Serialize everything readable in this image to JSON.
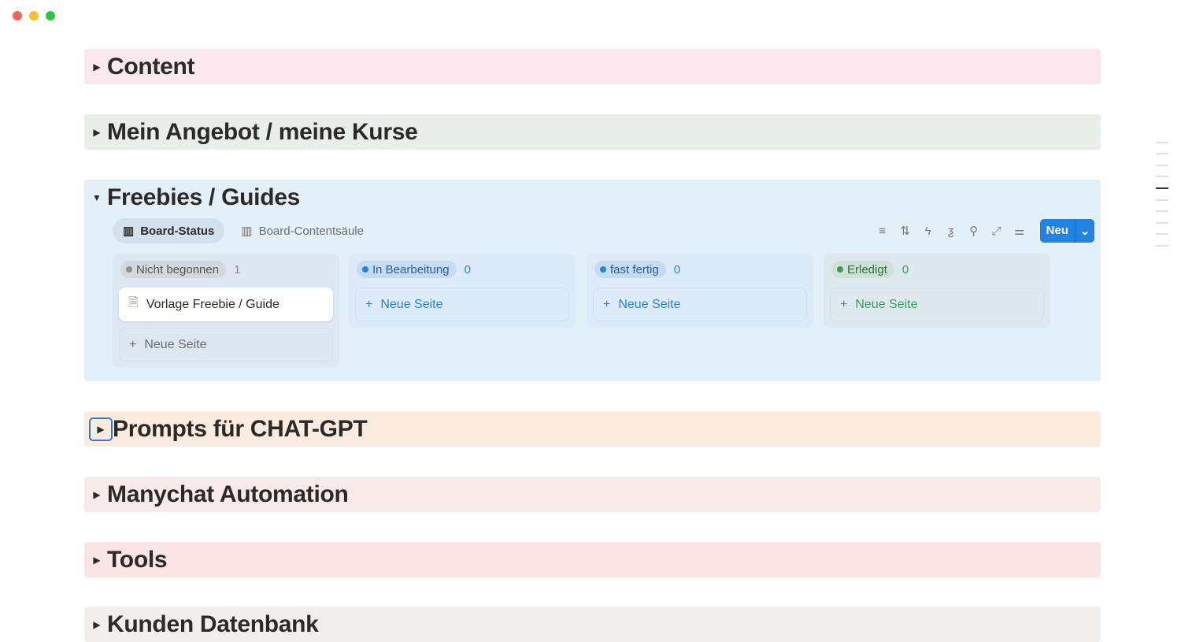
{
  "window": {
    "controls": [
      "close",
      "minimize",
      "zoom"
    ]
  },
  "sections": [
    {
      "title": "Content",
      "expanded": false,
      "color": "#fae8ef"
    },
    {
      "title": "Mein Angebot / meine Kurse",
      "expanded": false,
      "color": "#e8efea"
    },
    {
      "title": "Freebies / Guides",
      "expanded": true,
      "color": "#e3f0fa"
    },
    {
      "title": "Prompts für CHAT-GPT",
      "expanded": false,
      "color": "#fbecdf"
    },
    {
      "title": "Manychat Automation",
      "expanded": false,
      "color": "#f8ebe7"
    },
    {
      "title": "Tools",
      "expanded": false,
      "color": "#fbe5e4"
    },
    {
      "title": "Kunden Datenbank",
      "expanded": false,
      "color": "#f0efed"
    }
  ],
  "board": {
    "tabs": [
      {
        "label": "Board-Status",
        "active": true
      },
      {
        "label": "Board-Contentsäule",
        "active": false
      }
    ],
    "toolbar_icons": [
      "filter-icon",
      "sort-icon",
      "automation-icon",
      "formula-icon",
      "search-icon",
      "expand-icon",
      "settings-icon"
    ],
    "new_label": "Neu",
    "columns": [
      {
        "status": "Nicht begonnen",
        "count": "1",
        "dot": "#8f8e8a",
        "cards": [
          "Vorlage Freebie / Guide"
        ],
        "new_page": "Neue Seite"
      },
      {
        "status": "In Bearbeitung",
        "count": "0",
        "dot": "#2383e2",
        "cards": [],
        "new_page": "Neue Seite"
      },
      {
        "status": "fast fertig",
        "count": "0",
        "dot": "#2383e2",
        "cards": [],
        "new_page": "Neue Seite"
      },
      {
        "status": "Erledigt",
        "count": "0",
        "dot": "#3b9c5b",
        "cards": [],
        "new_page": "Neue Seite"
      }
    ]
  }
}
